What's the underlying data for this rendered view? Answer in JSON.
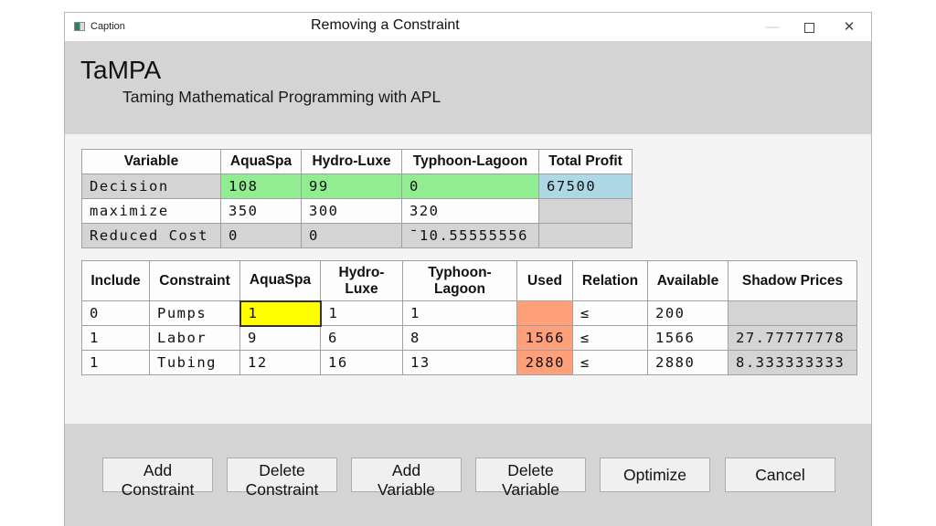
{
  "window": {
    "caption": "Caption",
    "slide_title": "Removing a Constraint",
    "controls": {
      "minimize": "—",
      "maximize": "",
      "close": "✕"
    }
  },
  "header": {
    "app_name": "TaMPA",
    "subtitle": "Taming Mathematical Programming with APL"
  },
  "variables_table": {
    "headers": [
      "Variable",
      "AquaSpa",
      "Hydro-Luxe",
      "Typhoon-Lagoon",
      "Total Profit"
    ],
    "rows": [
      {
        "label": "Decision",
        "values": [
          "108",
          "99",
          "0"
        ],
        "total": "67500"
      },
      {
        "label": "maximize",
        "values": [
          "350",
          "300",
          "320"
        ],
        "total": ""
      },
      {
        "label": "Reduced Cost",
        "values": [
          "0",
          "0",
          "¯10.55555556"
        ],
        "total": ""
      }
    ]
  },
  "constraints_table": {
    "headers": {
      "include": "Include",
      "constraint": "Constraint",
      "aquaspa": "AquaSpa",
      "hydro_1": "Hydro-",
      "hydro_2": "Luxe",
      "typhoon_1": "Typhoon-",
      "typhoon_2": "Lagoon",
      "used": "Used",
      "relation": "Relation",
      "available": "Available",
      "shadow": "Shadow Prices"
    },
    "rows": [
      {
        "include": "0",
        "name": "Pumps",
        "aquaspa": "1",
        "hydro": "1",
        "typhoon": "1",
        "used": "",
        "relation": "≤",
        "available": "200",
        "shadow": ""
      },
      {
        "include": "1",
        "name": "Labor",
        "aquaspa": "9",
        "hydro": "6",
        "typhoon": "8",
        "used": "1566",
        "relation": "≤",
        "available": "1566",
        "shadow": "27.77777778"
      },
      {
        "include": "1",
        "name": "Tubing",
        "aquaspa": "12",
        "hydro": "16",
        "typhoon": "13",
        "used": "2880",
        "relation": "≤",
        "available": "2880",
        "shadow": "8.333333333"
      }
    ]
  },
  "buttons": {
    "add_constraint": [
      "Add",
      "Constraint"
    ],
    "delete_constraint": [
      "Delete",
      "Constraint"
    ],
    "add_variable": [
      "Add",
      "Variable"
    ],
    "delete_variable": [
      "Delete",
      "Variable"
    ],
    "optimize": "Optimize",
    "cancel": "Cancel"
  },
  "colors": {
    "decision_cells": "#90ee90",
    "total_profit_cell": "#add8e6",
    "selected_cell": "#ffff00",
    "used_cells": "#ffa07a",
    "readonly_cells": "#d4d4d4"
  }
}
